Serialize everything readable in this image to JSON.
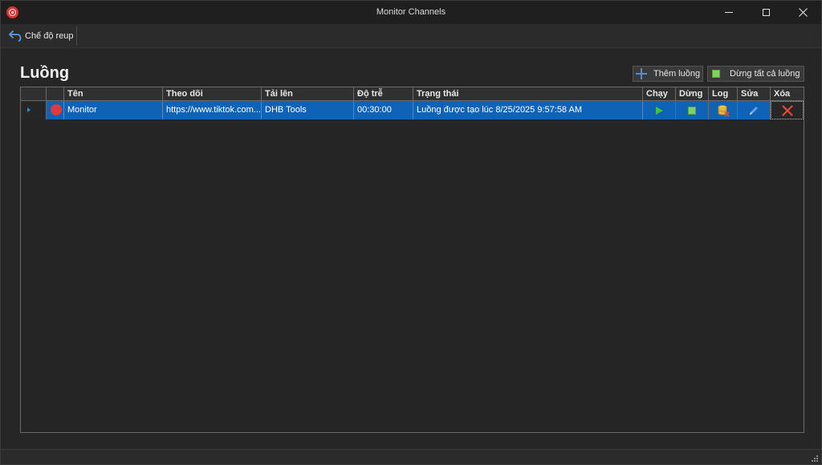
{
  "window": {
    "title": "Monitor Channels"
  },
  "toolbar": {
    "mode_label": "Chế độ reup"
  },
  "page": {
    "title": "Luồng",
    "add_label": "Thêm luồng",
    "stop_all_label": "Dừng tất cả luồng"
  },
  "grid": {
    "columns": [
      "Tên",
      "Theo dõi",
      "Tải lên",
      "Độ trễ",
      "Trạng thái",
      "Chạy",
      "Dừng",
      "Log",
      "Sửa",
      "Xóa"
    ],
    "rows": [
      {
        "name": "Monitor",
        "follow": "https://www.tiktok.com...",
        "upload": "DHB Tools",
        "delay": "00:30:00",
        "status": "Luồng được tạo lúc 8/25/2025 9:57:58 AM"
      }
    ]
  },
  "colors": {
    "selection": "#0f63b6",
    "status_dot": "#e13a3a",
    "play": "#42c23c",
    "stop": "#7fd35a",
    "delete": "#e04a3a",
    "accent": "#4f8fd8"
  },
  "icons": {
    "app": "broadcast-icon",
    "mode": "undo-arrow-icon",
    "add": "plus-icon",
    "stop_all": "stop-square-icon",
    "run": "play-icon",
    "stop": "stop-icon",
    "log": "database-delete-icon",
    "edit": "pencil-icon",
    "delete": "close-x-icon"
  }
}
